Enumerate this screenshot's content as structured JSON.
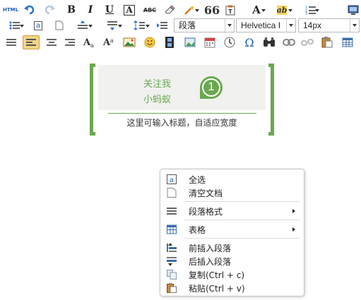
{
  "toolbar": {
    "row1": [
      {
        "name": "source-code-button",
        "text": "HTML"
      },
      {
        "name": "undo-button"
      },
      {
        "name": "redo-button"
      },
      {
        "name": "bold-button",
        "text": "B"
      },
      {
        "name": "italic-button",
        "text": "I"
      },
      {
        "name": "underline-button",
        "text": "U"
      },
      {
        "name": "font-border-button",
        "text": "A"
      },
      {
        "name": "strikethrough-button",
        "text": "ABC"
      },
      {
        "name": "eraser-button"
      },
      {
        "name": "auto-typeset-button"
      },
      {
        "name": "blockquote-button",
        "text": "66"
      },
      {
        "name": "paste-plain-button"
      },
      {
        "name": "forecolor-button",
        "text": "A"
      },
      {
        "name": "backcolor-button",
        "text": "ab"
      },
      {
        "name": "ordered-list-button"
      },
      {
        "name": "preview-button"
      }
    ],
    "paragraph_select": "段落",
    "font_select": "Helvetica I",
    "size_select": "14px",
    "row2_select_a": "a"
  },
  "editor": {
    "badge_line1": "关注我",
    "badge_line2": "小蚂蚁",
    "badge_number": "1",
    "badge_subtitle": "这里可输入标题，自适应宽度",
    "accent_color": "#6aa84f"
  },
  "context_menu": {
    "items": [
      {
        "label": "全选",
        "icon": "select-all-icon"
      },
      {
        "label": "清空文档",
        "icon": "clear-doc-icon"
      },
      {
        "label": "段落格式",
        "icon": "paragraph-icon",
        "submenu": true
      },
      {
        "label": "表格",
        "icon": "table-icon",
        "submenu": true
      },
      {
        "label": "前插入段落",
        "icon": "insert-before-icon"
      },
      {
        "label": "后插入段落",
        "icon": "insert-after-icon"
      },
      {
        "label": "复制(Ctrl + c)",
        "icon": "copy-icon"
      },
      {
        "label": "粘贴(Ctrl + v)",
        "icon": "paste-icon"
      }
    ]
  }
}
